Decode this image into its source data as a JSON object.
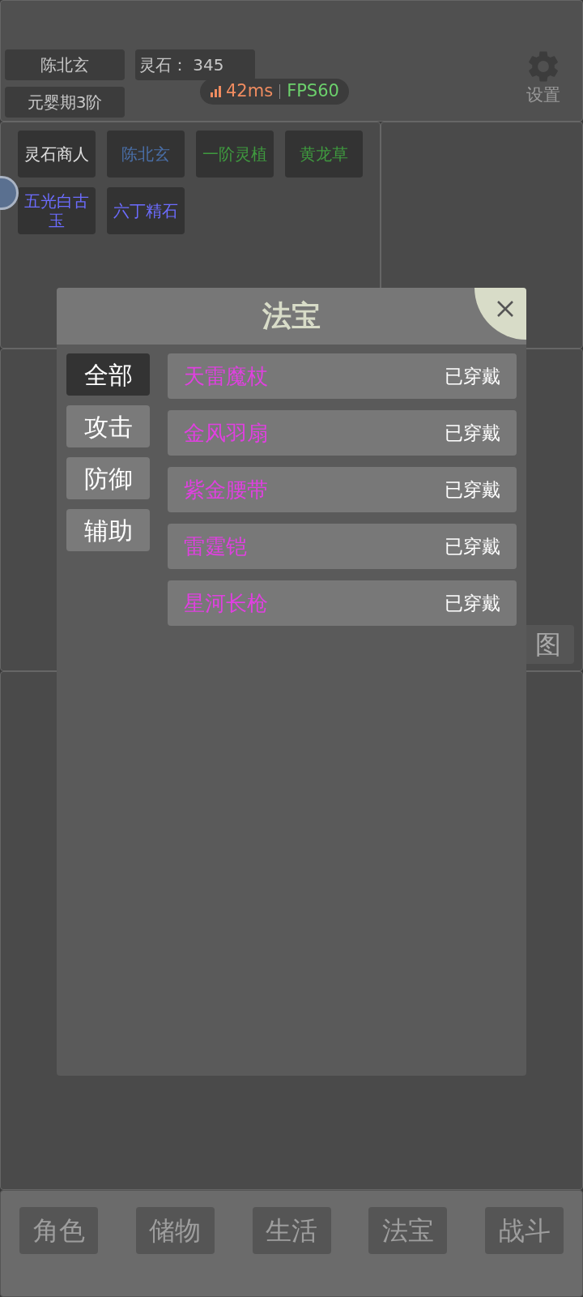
{
  "header": {
    "player_name": "陈北玄",
    "spirit_stone": {
      "label": "灵石：",
      "value": "345"
    },
    "realm": "元婴期3阶",
    "network": {
      "latency": "42ms",
      "fps": "FPS60"
    },
    "settings_label": "设置"
  },
  "chips": [
    {
      "label": "灵石商人",
      "color": "#e0e0e0"
    },
    {
      "label": "陈北玄",
      "color": "#4a6fa8"
    },
    {
      "label": "一阶灵植",
      "color": "#3f9a3f"
    },
    {
      "label": "黄龙草",
      "color": "#3f9a3f"
    },
    {
      "label": "五光白古玉",
      "color": "#6c6cff"
    },
    {
      "label": "六丁精石",
      "color": "#6c6cff"
    }
  ],
  "map_button": "图",
  "dialog": {
    "title": "法宝",
    "tabs": [
      {
        "label": "全部",
        "selected": true
      },
      {
        "label": "攻击",
        "selected": false
      },
      {
        "label": "防御",
        "selected": false
      },
      {
        "label": "辅助",
        "selected": false
      }
    ],
    "items": [
      {
        "name": "天雷魔杖",
        "status": "已穿戴",
        "color": "#e040e0"
      },
      {
        "name": "金风羽扇",
        "status": "已穿戴",
        "color": "#e040e0"
      },
      {
        "name": "紫金腰带",
        "status": "已穿戴",
        "color": "#e040e0"
      },
      {
        "name": "雷霆铠",
        "status": "已穿戴",
        "color": "#e040e0"
      },
      {
        "name": "星河长枪",
        "status": "已穿戴",
        "color": "#e040e0"
      }
    ]
  },
  "bottom_nav": [
    {
      "label": "角色"
    },
    {
      "label": "储物"
    },
    {
      "label": "生活"
    },
    {
      "label": "法宝"
    },
    {
      "label": "战斗"
    }
  ]
}
